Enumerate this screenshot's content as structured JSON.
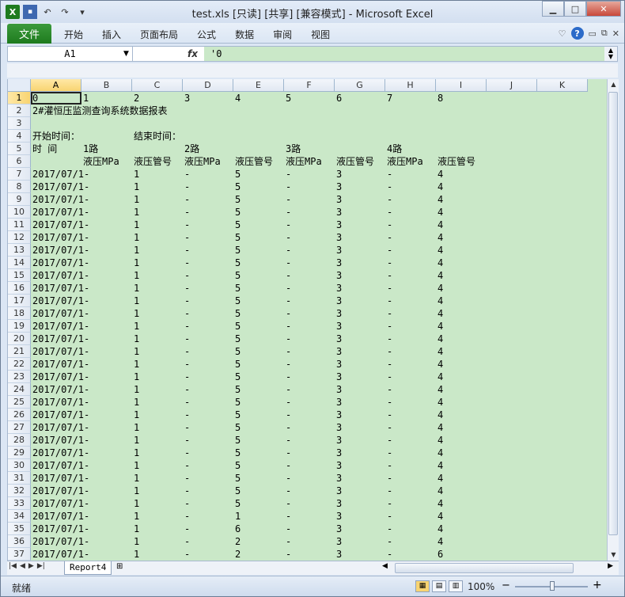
{
  "window": {
    "title": "test.xls  [只读]  [共享]  [兼容模式] - Microsoft Excel",
    "controls": {
      "minimize": "▁",
      "maximize": "□",
      "close": "✕"
    }
  },
  "qat": {
    "excel_icon": "X",
    "save_icon": "💾",
    "undo": "↶",
    "redo": "↷",
    "customize": "▾"
  },
  "ribbon": {
    "file_label": "文件",
    "tabs": [
      "开始",
      "插入",
      "页面布局",
      "公式",
      "数据",
      "审阅",
      "视图"
    ],
    "help": "?"
  },
  "formula_bar": {
    "name_box": "A1",
    "fx": "fx",
    "content": "'0"
  },
  "columns": [
    "A",
    "B",
    "C",
    "D",
    "E",
    "F",
    "G",
    "H",
    "I",
    "J",
    "K"
  ],
  "row_numbers": [
    "1",
    "2",
    "3",
    "4",
    "5",
    "6",
    "7",
    "8",
    "9",
    "10",
    "11",
    "12",
    "13",
    "14",
    "15",
    "16",
    "17",
    "18",
    "19",
    "20",
    "21",
    "22",
    "23",
    "24",
    "25",
    "26",
    "27",
    "28",
    "29",
    "30",
    "31",
    "32",
    "33",
    "34",
    "35",
    "36",
    "37"
  ],
  "header_rows": {
    "r1": [
      "0",
      "1",
      "2",
      "3",
      "4",
      "5",
      "6",
      "7",
      "8"
    ],
    "r2_title": "2#灌恒压监测查询系统数据报表",
    "r4_start": "开始时间：",
    "r4_end": "结束时间：",
    "r5": {
      "a": "时  间",
      "b": "1路",
      "d": "2路",
      "f": "3路",
      "h": "4路"
    },
    "r6": {
      "b": "液压MPa",
      "c": "液压管号",
      "d": "液压MPa",
      "e": "液压管号",
      "f": "液压MPa",
      "g": "液压管号",
      "h": "液压MPa",
      "i": "液压管号"
    }
  },
  "data_rows": [
    [
      "2017/07/1-",
      "1",
      "-",
      "5",
      "-",
      "3",
      "-",
      "4"
    ],
    [
      "2017/07/1-",
      "1",
      "-",
      "5",
      "-",
      "3",
      "-",
      "4"
    ],
    [
      "2017/07/1-",
      "1",
      "-",
      "5",
      "-",
      "3",
      "-",
      "4"
    ],
    [
      "2017/07/1-",
      "1",
      "-",
      "5",
      "-",
      "3",
      "-",
      "4"
    ],
    [
      "2017/07/1-",
      "1",
      "-",
      "5",
      "-",
      "3",
      "-",
      "4"
    ],
    [
      "2017/07/1-",
      "1",
      "-",
      "5",
      "-",
      "3",
      "-",
      "4"
    ],
    [
      "2017/07/1-",
      "1",
      "-",
      "5",
      "-",
      "3",
      "-",
      "4"
    ],
    [
      "2017/07/1-",
      "1",
      "-",
      "5",
      "-",
      "3",
      "-",
      "4"
    ],
    [
      "2017/07/1-",
      "1",
      "-",
      "5",
      "-",
      "3",
      "-",
      "4"
    ],
    [
      "2017/07/1-",
      "1",
      "-",
      "5",
      "-",
      "3",
      "-",
      "4"
    ],
    [
      "2017/07/1-",
      "1",
      "-",
      "5",
      "-",
      "3",
      "-",
      "4"
    ],
    [
      "2017/07/1-",
      "1",
      "-",
      "5",
      "-",
      "3",
      "-",
      "4"
    ],
    [
      "2017/07/1-",
      "1",
      "-",
      "5",
      "-",
      "3",
      "-",
      "4"
    ],
    [
      "2017/07/1-",
      "1",
      "-",
      "5",
      "-",
      "3",
      "-",
      "4"
    ],
    [
      "2017/07/1-",
      "1",
      "-",
      "5",
      "-",
      "3",
      "-",
      "4"
    ],
    [
      "2017/07/1-",
      "1",
      "-",
      "5",
      "-",
      "3",
      "-",
      "4"
    ],
    [
      "2017/07/1-",
      "1",
      "-",
      "5",
      "-",
      "3",
      "-",
      "4"
    ],
    [
      "2017/07/1-",
      "1",
      "-",
      "5",
      "-",
      "3",
      "-",
      "4"
    ],
    [
      "2017/07/1-",
      "1",
      "-",
      "5",
      "-",
      "3",
      "-",
      "4"
    ],
    [
      "2017/07/1-",
      "1",
      "-",
      "5",
      "-",
      "3",
      "-",
      "4"
    ],
    [
      "2017/07/1-",
      "1",
      "-",
      "5",
      "-",
      "3",
      "-",
      "4"
    ],
    [
      "2017/07/1-",
      "1",
      "-",
      "5",
      "-",
      "3",
      "-",
      "4"
    ],
    [
      "2017/07/1-",
      "1",
      "-",
      "5",
      "-",
      "3",
      "-",
      "4"
    ],
    [
      "2017/07/1-",
      "1",
      "-",
      "5",
      "-",
      "3",
      "-",
      "4"
    ],
    [
      "2017/07/1-",
      "1",
      "-",
      "5",
      "-",
      "3",
      "-",
      "4"
    ],
    [
      "2017/07/1-",
      "1",
      "-",
      "5",
      "-",
      "3",
      "-",
      "4"
    ],
    [
      "2017/07/1-",
      "1",
      "-",
      "5",
      "-",
      "3",
      "-",
      "4"
    ],
    [
      "2017/07/1-",
      "1",
      "-",
      "1",
      "-",
      "3",
      "-",
      "4"
    ],
    [
      "2017/07/1-",
      "1",
      "-",
      "6",
      "-",
      "3",
      "-",
      "4"
    ],
    [
      "2017/07/1-",
      "1",
      "-",
      "2",
      "-",
      "3",
      "-",
      "4"
    ],
    [
      "2017/07/1-",
      "1",
      "-",
      "2",
      "-",
      "3",
      "-",
      "6"
    ]
  ],
  "sheet_tab": "Report4",
  "status": {
    "ready": "就绪",
    "zoom": "100%",
    "zoom_minus": "−",
    "zoom_plus": "+"
  },
  "colors": {
    "cell_fill": "#cae8c8",
    "file_tab": "#1e7b1e",
    "selected_header": "#f8d471"
  }
}
